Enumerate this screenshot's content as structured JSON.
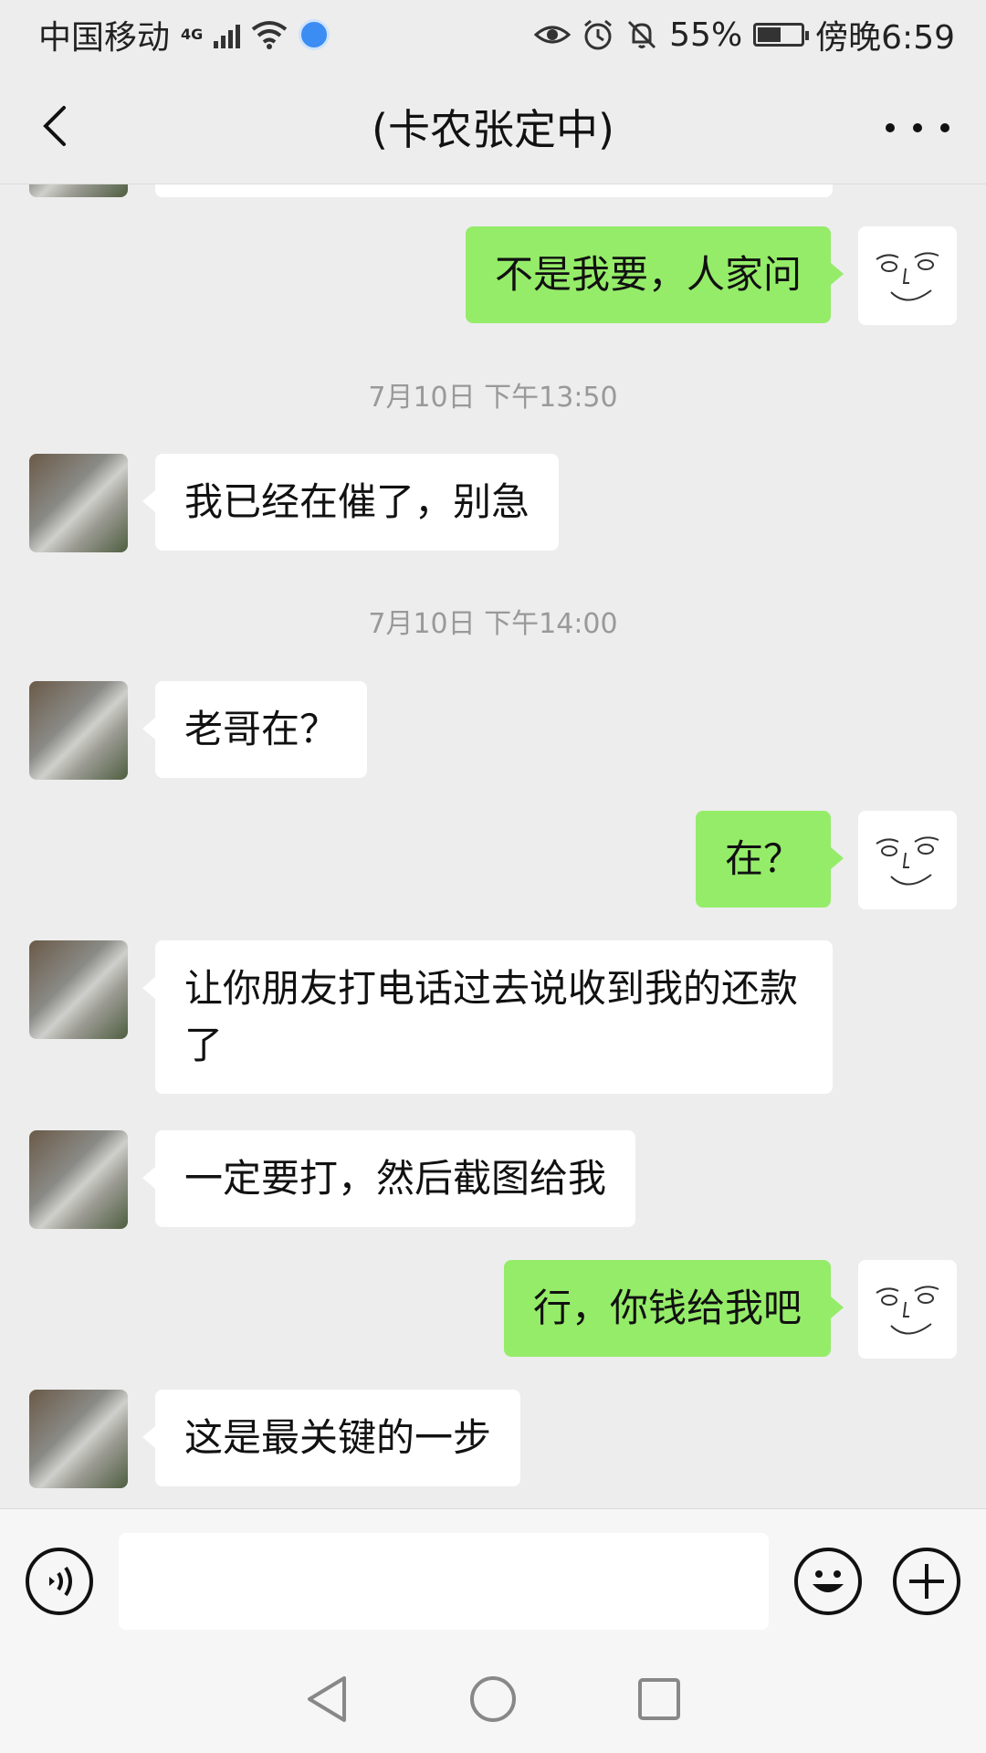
{
  "status_bar": {
    "carrier": "中国移动",
    "network": "4G",
    "battery_percent": "55%",
    "battery_level": 0.55,
    "time": "傍晚6:59",
    "icons": [
      "signal-icon",
      "wifi-icon",
      "browser-icon",
      "eye-icon",
      "alarm-icon",
      "mute-icon",
      "battery-icon"
    ]
  },
  "header": {
    "title": "(卡农张定中)"
  },
  "messages": [
    {
      "type": "text",
      "direction": "out",
      "text": "不是我要，人家问"
    },
    {
      "type": "time",
      "text": "7月10日 下午13:50"
    },
    {
      "type": "text",
      "direction": "in",
      "text": "我已经在催了，别急"
    },
    {
      "type": "time",
      "text": "7月10日 下午14:00"
    },
    {
      "type": "text",
      "direction": "in",
      "text": "老哥在？"
    },
    {
      "type": "text",
      "direction": "out",
      "text": "在？"
    },
    {
      "type": "text",
      "direction": "in",
      "text": "让你朋友打电话过去说收到我的还款了"
    },
    {
      "type": "text",
      "direction": "in",
      "text": "一定要打，然后截图给我"
    },
    {
      "type": "text",
      "direction": "out",
      "text": "行，你钱给我吧"
    },
    {
      "type": "text",
      "direction": "in",
      "text": "这是最关键的一步"
    }
  ],
  "input": {
    "placeholder": "",
    "value": ""
  },
  "colors": {
    "background": "#ededed",
    "outgoing_bubble": "#95ec69",
    "incoming_bubble": "#ffffff",
    "timestamp_text": "#999999"
  }
}
